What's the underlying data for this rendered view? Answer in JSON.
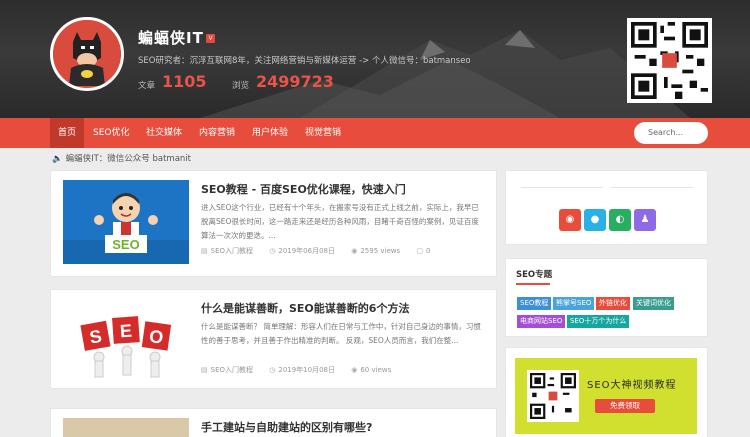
{
  "header": {
    "title": "蝙蝠侠IT",
    "v_badge": "V",
    "description": "SEO研究者：沉浮互联网8年，关注网络营销与新媒体运营 -> 个人微信号：batmanseo",
    "stats": [
      {
        "label": "文章",
        "value": "1105"
      },
      {
        "label": "浏览",
        "value": "2499723"
      }
    ]
  },
  "nav": {
    "items": [
      {
        "label": "首页",
        "active": true
      },
      {
        "label": "SEO优化"
      },
      {
        "label": "社交媒体"
      },
      {
        "label": "内容营销"
      },
      {
        "label": "用户体验"
      },
      {
        "label": "视觉营销"
      }
    ],
    "search_placeholder": "Search..."
  },
  "notice": "蝙蝠侠IT：微信公众号 batmanit",
  "articles": [
    {
      "title": "SEO教程 - 百度SEO优化课程，快速入门",
      "excerpt": "进入SEO这个行业，已经有十个年头，在搬家号没有正式上线之前，实际上，我早已脱离SEO很长时间，这一路走来还是经历各种风雨，目睹千奇百怪的案例，见证百度算法一次次的更迭。...",
      "category": "SEO入门教程",
      "date": "2019年06月08日",
      "views": "2595 views",
      "comments": "0"
    },
    {
      "title": "什么是能谋善断，SEO能谋善断的6个方法",
      "excerpt": "什么是能谋善断？ 简单理解：形容人们在日常与工作中，针对自己身边的事情，习惯性的善于思考，并且善于作出精准的判断。 反观，SEO人员而言，我们在整...",
      "category": "SEO入门教程",
      "date": "2019年10月08日",
      "views": "60 views",
      "comments": ""
    },
    {
      "title": "手工建站与自助建站的区别有哪些?",
      "excerpt": "",
      "category": "",
      "date": "",
      "views": "",
      "comments": ""
    }
  ],
  "sidebar": {
    "social_icons": [
      "weibo-icon",
      "qq-icon",
      "wechat-icon",
      "group-icon"
    ],
    "topics_title": "SEO专题",
    "tags": [
      "SEO教程",
      "熊掌号SEO",
      "外链优化",
      "关键词优化",
      "电商网站SEO",
      "SEO十万个为什么"
    ],
    "promo_title": "SEO大神视频教程",
    "promo_button": "免费领取"
  },
  "colors": {
    "accent": "#e74c3c",
    "nav_active": "#c0392b",
    "stat": "#e8544a",
    "promo_bg": "#d1e02e"
  }
}
